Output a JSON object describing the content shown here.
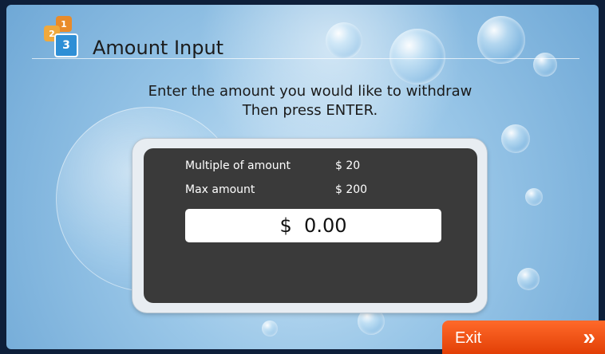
{
  "header": {
    "step_small_1": "1",
    "step_small_2": "2",
    "step_current": "3",
    "title": "Amount Input"
  },
  "instructions": {
    "line1": "Enter the amount you would like to withdraw",
    "line2": "Then press ENTER."
  },
  "limits": {
    "multiple_label": "Multiple of amount",
    "multiple_value": "$ 20",
    "max_label": "Max amount",
    "max_value": "$ 200"
  },
  "amount": {
    "display": "$  0.00"
  },
  "footer": {
    "exit_label": "Exit",
    "exit_icon": "double-chevron-right-icon"
  },
  "colors": {
    "exit_button": "#e8470a",
    "inner_panel": "#3a3a3a",
    "background": "#9ac7e8"
  }
}
